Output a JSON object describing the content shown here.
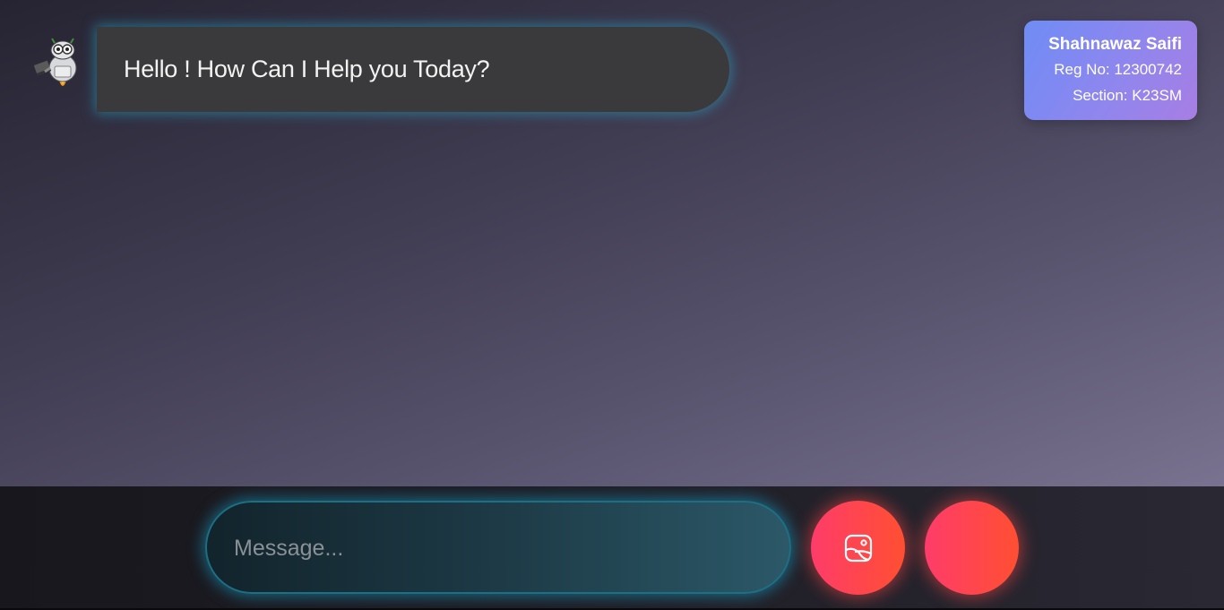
{
  "chat": {
    "messages": [
      {
        "sender": "bot",
        "avatar_icon": "robot-avatar-icon",
        "text": "Hello ! How Can I Help you Today?"
      }
    ]
  },
  "info_card": {
    "name": "Shahnawaz Saifi",
    "reg_no": "Reg No: 12300742",
    "section": "Section: K23SM"
  },
  "input_bar": {
    "placeholder": "Message...",
    "value": "",
    "image_button_icon": "image-upload-icon",
    "send_button_icon": ""
  },
  "colors": {
    "bubble": "#3a3a3c",
    "bubble_glow": "#28aac8",
    "card_gradient_start": "#6f8cf5",
    "card_gradient_end": "#a77ee3",
    "button_gradient_start": "#ff3c6a",
    "button_gradient_end": "#ff4f32"
  }
}
